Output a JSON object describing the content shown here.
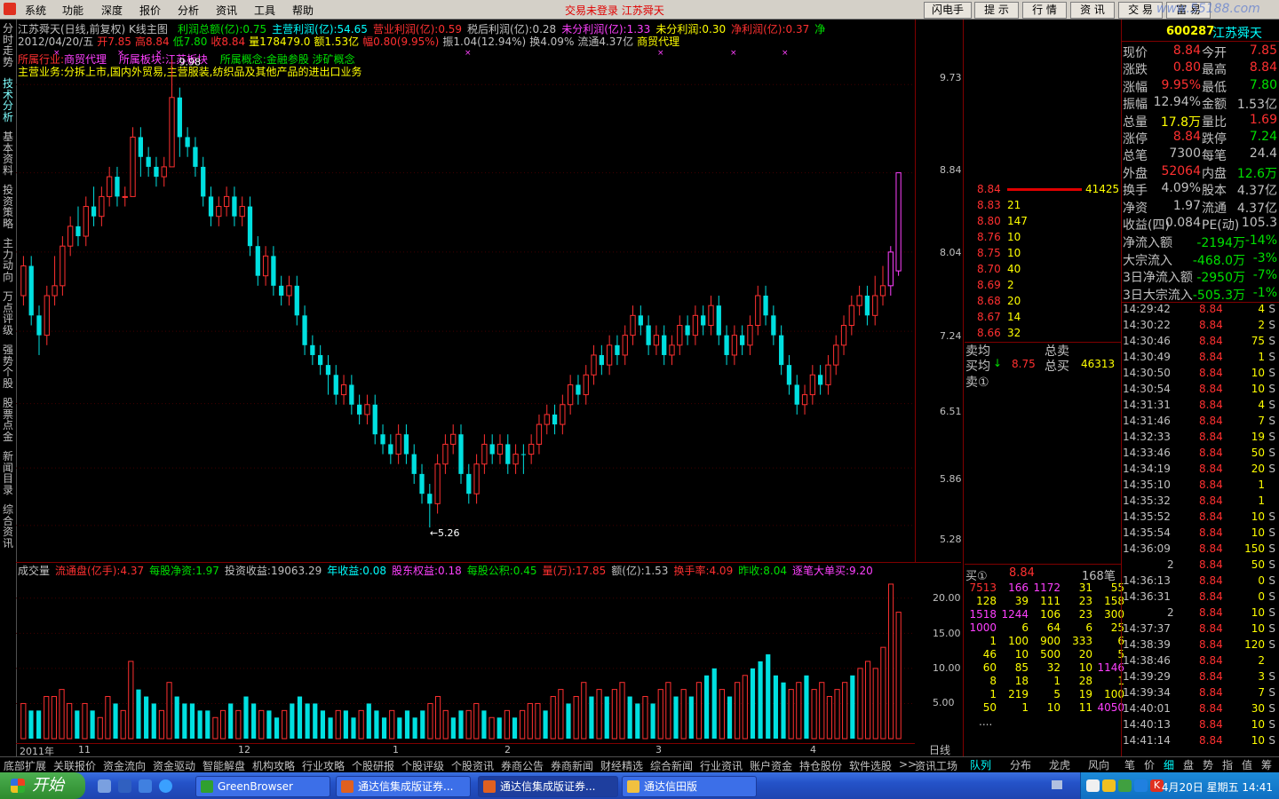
{
  "menubar": {
    "items": [
      "系统",
      "功能",
      "深度",
      "报价",
      "分析",
      "资讯",
      "工具",
      "帮助"
    ],
    "status": "交易未登录  江苏舜天",
    "right_buttons": [
      "闪电手",
      "提 示",
      "行 情",
      "资 讯",
      "交 易",
      "富 易"
    ],
    "watermark": "www.55188.com"
  },
  "left_tabs": [
    "分时走势",
    "技术分析",
    "基本资料",
    "投资策略",
    "主力动向",
    "万点评级",
    "强势个股",
    "股票点金",
    "新闻目录",
    "综合资讯"
  ],
  "info": {
    "title": "江苏舜天(日线,前复权) K线主图",
    "fin1": [
      {
        "t": "利润总额(亿):0.75",
        "c": "g"
      },
      {
        "t": "主营利润(亿):54.65",
        "c": "c"
      },
      {
        "t": "营业利润(亿):0.59",
        "c": "r"
      },
      {
        "t": "税后利润(亿):0.28",
        "c": "w"
      },
      {
        "t": "未分利润(亿):1.33",
        "c": "m"
      },
      {
        "t": "未分利润:0.30",
        "c": "y"
      },
      {
        "t": "净利润(亿):0.37",
        "c": "r"
      },
      {
        "t": "净",
        "c": "g"
      }
    ],
    "kline": [
      {
        "t": "2012/04/20/五",
        "c": "w"
      },
      {
        "t": "开7.85",
        "c": "r"
      },
      {
        "t": "高8.84",
        "c": "r"
      },
      {
        "t": "低7.80",
        "c": "g"
      },
      {
        "t": "收8.84",
        "c": "r"
      },
      {
        "t": "量178479.0",
        "c": "y"
      },
      {
        "t": "额1.53亿",
        "c": "y"
      },
      {
        "t": "幅0.80(9.95%)",
        "c": "r"
      },
      {
        "t": "振1.04(12.94%)",
        "c": "w"
      },
      {
        "t": "换4.09%",
        "c": "w"
      },
      {
        "t": "流通4.37亿",
        "c": "w"
      },
      {
        "t": "商贸代理",
        "c": "y"
      }
    ],
    "industry_label": "所属行业:",
    "industry_value": "商贸代理",
    "board_label": "所属板块:",
    "board_value": "江苏板块",
    "concept_label": "所属概念:",
    "concept_value": "金融参股 涉矿概念",
    "main_label": "主营业务:",
    "main_value": "分拆上市,国内外贸易,主营服装,纺织品及其他产品的进出口业务",
    "pointer_label": "9.98",
    "low_label": "←5.26"
  },
  "kchart": {
    "yaxis": [
      "9.73",
      "8.84",
      "8.04",
      "7.24",
      "6.51",
      "5.86",
      "5.28"
    ],
    "xlabels": [
      "2011年",
      "11",
      "12",
      "1",
      "2",
      "3",
      "4"
    ],
    "period": "日线"
  },
  "vol": {
    "header": [
      {
        "t": "成交量",
        "c": "w"
      },
      {
        "t": "流通盘(亿手):4.37",
        "c": "r"
      },
      {
        "t": "每股净资:1.97",
        "c": "g"
      },
      {
        "t": "投资收益:19063.29",
        "c": "w"
      },
      {
        "t": "年收益:0.08",
        "c": "c"
      },
      {
        "t": "股东权益:0.18",
        "c": "m"
      },
      {
        "t": "每股公积:0.45",
        "c": "g"
      },
      {
        "t": "量(万):17.85",
        "c": "r"
      },
      {
        "t": "额(亿):1.53",
        "c": "w"
      },
      {
        "t": "换手率:4.09",
        "c": "r"
      },
      {
        "t": "昨收:8.04",
        "c": "g"
      },
      {
        "t": "逐笔大单买:9.20",
        "c": "m"
      }
    ],
    "yaxis": [
      "20.00",
      "15.00",
      "10.00",
      "5.00"
    ]
  },
  "chart_data": {
    "type": "candlestick",
    "title": "江苏舜天(日线,前复权) K线主图",
    "ylim": [
      5.1,
      10.1
    ],
    "candles": [
      [
        7.6,
        7.9,
        7.5,
        8.0,
        1
      ],
      [
        7.9,
        7.4,
        7.3,
        8.0,
        0
      ],
      [
        7.4,
        7.2,
        7.0,
        7.5,
        0
      ],
      [
        7.2,
        7.6,
        7.1,
        7.7,
        1
      ],
      [
        7.6,
        7.7,
        7.5,
        8.0,
        1
      ],
      [
        7.7,
        8.1,
        7.6,
        8.2,
        1
      ],
      [
        8.1,
        8.3,
        8.0,
        8.4,
        1
      ],
      [
        8.3,
        8.2,
        8.1,
        8.5,
        0
      ],
      [
        8.2,
        8.5,
        8.1,
        8.6,
        1
      ],
      [
        8.5,
        8.4,
        8.3,
        8.7,
        0
      ],
      [
        8.4,
        8.6,
        8.3,
        8.7,
        1
      ],
      [
        8.6,
        8.8,
        8.5,
        8.9,
        1
      ],
      [
        8.8,
        8.6,
        8.5,
        8.9,
        0
      ],
      [
        8.6,
        8.6,
        8.5,
        8.7,
        1
      ],
      [
        8.6,
        9.2,
        8.6,
        9.3,
        1
      ],
      [
        9.2,
        9.0,
        8.8,
        9.3,
        0
      ],
      [
        9.0,
        8.9,
        8.8,
        9.1,
        0
      ],
      [
        8.9,
        8.8,
        8.7,
        9.0,
        0
      ],
      [
        8.8,
        8.9,
        8.7,
        9.0,
        1
      ],
      [
        8.9,
        9.6,
        8.9,
        9.98,
        1
      ],
      [
        9.6,
        9.2,
        9.0,
        9.7,
        0
      ],
      [
        9.2,
        9.1,
        9.0,
        9.3,
        0
      ],
      [
        9.1,
        8.9,
        8.8,
        9.2,
        0
      ],
      [
        8.9,
        8.6,
        8.5,
        9.0,
        0
      ],
      [
        8.6,
        8.4,
        8.3,
        8.7,
        0
      ],
      [
        8.4,
        8.5,
        8.3,
        8.6,
        1
      ],
      [
        8.5,
        8.6,
        8.4,
        8.7,
        1
      ],
      [
        8.6,
        8.4,
        8.3,
        8.7,
        0
      ],
      [
        8.4,
        8.5,
        8.3,
        8.6,
        1
      ],
      [
        8.5,
        8.1,
        8.0,
        8.6,
        0
      ],
      [
        8.1,
        7.8,
        7.7,
        8.2,
        0
      ],
      [
        7.8,
        8.0,
        7.7,
        8.1,
        1
      ],
      [
        8.0,
        7.7,
        7.6,
        8.1,
        0
      ],
      [
        7.7,
        7.6,
        7.5,
        7.8,
        0
      ],
      [
        7.6,
        7.7,
        7.5,
        7.8,
        1
      ],
      [
        7.7,
        7.4,
        7.3,
        7.8,
        0
      ],
      [
        7.4,
        7.1,
        7.0,
        7.5,
        0
      ],
      [
        7.1,
        7.0,
        6.9,
        7.2,
        0
      ],
      [
        7.0,
        6.9,
        6.8,
        7.1,
        0
      ],
      [
        6.9,
        6.8,
        6.6,
        7.0,
        0
      ],
      [
        6.8,
        6.6,
        6.5,
        6.9,
        0
      ],
      [
        6.6,
        6.7,
        6.5,
        6.8,
        1
      ],
      [
        6.7,
        6.5,
        6.4,
        6.8,
        0
      ],
      [
        6.5,
        6.4,
        6.3,
        6.6,
        0
      ],
      [
        6.4,
        6.5,
        6.3,
        6.6,
        1
      ],
      [
        6.5,
        6.2,
        6.1,
        6.6,
        0
      ],
      [
        6.2,
        6.1,
        6.0,
        6.3,
        0
      ],
      [
        6.1,
        6.0,
        5.9,
        6.2,
        0
      ],
      [
        6.0,
        6.2,
        5.9,
        6.3,
        1
      ],
      [
        6.2,
        6.0,
        5.9,
        6.3,
        0
      ],
      [
        6.0,
        5.8,
        5.7,
        6.1,
        0
      ],
      [
        5.8,
        5.6,
        5.5,
        5.9,
        0
      ],
      [
        5.6,
        5.5,
        5.26,
        5.7,
        0
      ],
      [
        5.5,
        5.9,
        5.4,
        6.0,
        1
      ],
      [
        5.9,
        6.1,
        5.8,
        6.2,
        1
      ],
      [
        6.1,
        6.2,
        6.0,
        6.3,
        1
      ],
      [
        6.2,
        5.8,
        5.7,
        6.3,
        0
      ],
      [
        5.8,
        5.6,
        5.5,
        5.9,
        0
      ],
      [
        5.6,
        5.9,
        5.5,
        6.0,
        1
      ],
      [
        5.9,
        6.1,
        5.8,
        6.2,
        1
      ],
      [
        6.1,
        6.0,
        5.9,
        6.2,
        0
      ],
      [
        6.0,
        6.1,
        5.9,
        6.2,
        1
      ],
      [
        6.1,
        5.9,
        5.8,
        6.2,
        0
      ],
      [
        5.9,
        6.0,
        5.8,
        6.1,
        1
      ],
      [
        6.0,
        6.0,
        5.8,
        6.1,
        0
      ],
      [
        6.0,
        6.1,
        5.9,
        6.2,
        1
      ],
      [
        6.1,
        6.3,
        6.0,
        6.4,
        1
      ],
      [
        6.3,
        6.4,
        6.2,
        6.5,
        1
      ],
      [
        6.4,
        6.3,
        6.2,
        6.5,
        0
      ],
      [
        6.3,
        6.5,
        6.2,
        6.6,
        1
      ],
      [
        6.5,
        6.7,
        6.4,
        6.8,
        1
      ],
      [
        6.7,
        6.6,
        6.5,
        6.8,
        0
      ],
      [
        6.6,
        6.8,
        6.5,
        6.9,
        1
      ],
      [
        6.8,
        7.0,
        6.7,
        7.1,
        1
      ],
      [
        7.0,
        6.9,
        6.8,
        7.1,
        0
      ],
      [
        6.9,
        7.1,
        6.8,
        7.2,
        1
      ],
      [
        7.1,
        7.0,
        6.9,
        7.2,
        0
      ],
      [
        7.0,
        7.2,
        6.9,
        7.3,
        1
      ],
      [
        7.2,
        7.4,
        7.1,
        7.5,
        1
      ],
      [
        7.4,
        7.3,
        7.2,
        7.5,
        0
      ],
      [
        7.3,
        7.1,
        7.0,
        7.4,
        0
      ],
      [
        7.1,
        7.2,
        7.0,
        7.3,
        1
      ],
      [
        7.2,
        7.0,
        6.9,
        7.3,
        0
      ],
      [
        7.0,
        7.1,
        6.9,
        7.2,
        1
      ],
      [
        7.1,
        7.3,
        7.0,
        7.4,
        1
      ],
      [
        7.3,
        7.2,
        7.1,
        7.4,
        0
      ],
      [
        7.2,
        7.4,
        7.1,
        7.5,
        1
      ],
      [
        7.4,
        7.3,
        7.2,
        7.5,
        0
      ],
      [
        7.3,
        7.5,
        7.2,
        7.6,
        1
      ],
      [
        7.5,
        7.2,
        7.1,
        7.6,
        0
      ],
      [
        7.2,
        7.0,
        6.9,
        7.3,
        0
      ],
      [
        7.0,
        7.2,
        6.9,
        7.3,
        1
      ],
      [
        7.2,
        7.1,
        7.0,
        7.3,
        0
      ],
      [
        7.1,
        7.3,
        7.0,
        7.4,
        1
      ],
      [
        7.3,
        7.6,
        7.2,
        7.7,
        1
      ],
      [
        7.6,
        7.4,
        7.3,
        7.7,
        0
      ],
      [
        7.4,
        7.2,
        7.1,
        7.5,
        0
      ],
      [
        7.2,
        6.9,
        6.8,
        7.3,
        0
      ],
      [
        6.9,
        6.7,
        6.6,
        7.0,
        0
      ],
      [
        6.7,
        6.5,
        6.4,
        6.8,
        0
      ],
      [
        6.5,
        6.6,
        6.4,
        6.7,
        1
      ],
      [
        6.6,
        6.8,
        6.5,
        6.9,
        1
      ],
      [
        6.8,
        6.7,
        6.6,
        6.9,
        0
      ],
      [
        6.7,
        6.9,
        6.6,
        7.0,
        1
      ],
      [
        6.9,
        7.1,
        6.8,
        7.2,
        1
      ],
      [
        7.1,
        7.3,
        7.0,
        7.4,
        1
      ],
      [
        7.3,
        7.5,
        7.2,
        7.6,
        1
      ],
      [
        7.5,
        7.6,
        7.4,
        7.7,
        1
      ],
      [
        7.6,
        7.4,
        7.3,
        7.7,
        0
      ],
      [
        7.4,
        7.6,
        7.3,
        7.8,
        1
      ],
      [
        7.6,
        7.7,
        7.5,
        7.9,
        1
      ],
      [
        7.7,
        8.04,
        7.6,
        8.1,
        1
      ],
      [
        7.85,
        8.84,
        7.8,
        8.84,
        1
      ]
    ],
    "volumes": [
      5,
      4,
      4,
      6,
      6,
      7,
      5,
      4,
      5,
      4,
      3,
      6,
      5,
      4,
      11,
      7,
      6,
      5,
      4,
      8,
      6,
      5,
      5,
      4,
      4,
      3,
      4,
      5,
      4,
      6,
      5,
      4,
      4,
      3,
      4,
      5,
      6,
      5,
      5,
      4,
      3,
      4,
      4,
      3,
      4,
      5,
      4,
      3,
      4,
      3,
      4,
      3,
      4,
      5,
      6,
      4,
      3,
      4,
      4,
      5,
      4,
      3,
      3,
      4,
      3,
      4,
      5,
      5,
      4,
      6,
      7,
      5,
      6,
      8,
      6,
      7,
      6,
      7,
      8,
      6,
      5,
      6,
      5,
      7,
      8,
      6,
      7,
      6,
      8,
      9,
      10,
      7,
      6,
      8,
      9,
      10,
      11,
      12,
      9,
      8,
      7,
      8,
      9,
      7,
      8,
      6,
      7,
      8,
      9,
      10,
      11,
      10,
      13,
      22,
      18
    ]
  },
  "orderbook": {
    "sells": [
      [
        "8.84",
        "41425"
      ],
      [
        "8.83",
        "21"
      ],
      [
        "8.80",
        "147"
      ],
      [
        "8.76",
        "10"
      ],
      [
        "8.75",
        "10"
      ],
      [
        "8.70",
        "40"
      ],
      [
        "8.69",
        "2"
      ],
      [
        "8.68",
        "20"
      ],
      [
        "8.67",
        "14"
      ],
      [
        "8.66",
        "32"
      ]
    ],
    "avg_sell": "卖均",
    "total_sell": "总卖",
    "avg_buy": "买均",
    "avg_buy_price": "8.75",
    "total_buy": "总买",
    "total_buy_value": "46313",
    "sell1": "卖①",
    "buy1_label": "买①",
    "buy1_price": "8.84",
    "buy1_count": "168笔",
    "queue": [
      [
        "7513",
        "166",
        "1172",
        "31",
        "55"
      ],
      [
        "128",
        "39",
        "111",
        "23",
        "158"
      ],
      [
        "1518",
        "1244",
        "106",
        "23",
        "300"
      ],
      [
        "1000",
        "6",
        "64",
        "6",
        "25"
      ],
      [
        "1",
        "100",
        "900",
        "333",
        "6"
      ],
      [
        "46",
        "10",
        "500",
        "20",
        "5"
      ],
      [
        "60",
        "85",
        "32",
        "10",
        "1146"
      ],
      [
        "8",
        "18",
        "1",
        "28",
        "1"
      ],
      [
        "1",
        "219",
        "5",
        "19",
        "100"
      ],
      [
        "50",
        "1",
        "10",
        "11",
        "4050"
      ]
    ],
    "more": "....",
    "tabs": [
      "队列",
      "分布",
      "龙虎",
      "风向"
    ]
  },
  "quote": {
    "code": "600287",
    "name": "江苏舜天",
    "rows": [
      [
        [
          "现价",
          "8.84",
          "r"
        ],
        [
          "今开",
          "7.85",
          "r"
        ]
      ],
      [
        [
          "涨跌",
          "0.80",
          "r"
        ],
        [
          "最高",
          "8.84",
          "r"
        ]
      ],
      [
        [
          "涨幅",
          "9.95%",
          "r"
        ],
        [
          "最低",
          "7.80",
          "g"
        ]
      ],
      [
        [
          "振幅",
          "12.94%",
          "w"
        ],
        [
          "金额",
          "1.53亿",
          "w"
        ]
      ],
      [
        [
          "总量",
          "17.8万",
          "y"
        ],
        [
          "量比",
          "1.69",
          "r"
        ]
      ],
      [
        [
          "涨停",
          "8.84",
          "r"
        ],
        [
          "跌停",
          "7.24",
          "g"
        ]
      ],
      [
        [
          "总笔",
          "7300",
          "w"
        ],
        [
          "每笔",
          "24.4",
          "w"
        ]
      ],
      [
        [
          "外盘",
          "52064",
          "r"
        ],
        [
          "内盘",
          "12.6万",
          "g"
        ]
      ],
      [
        [
          "换手",
          "4.09%",
          "w"
        ],
        [
          "股本",
          "4.37亿",
          "w"
        ]
      ],
      [
        [
          "净资",
          "1.97",
          "w"
        ],
        [
          "流通",
          "4.37亿",
          "w"
        ]
      ],
      [
        [
          "收益(四)",
          "0.084",
          "w"
        ],
        [
          "PE(动)",
          "105.3",
          "w"
        ]
      ]
    ],
    "flows": [
      [
        "净流入额",
        "-2194万",
        "-14%"
      ],
      [
        "大宗流入",
        "-468.0万",
        "-3%"
      ],
      [
        "3日净流入额",
        "-2950万",
        "-7%"
      ],
      [
        "3日大宗流入",
        "-505.3万",
        "-1%"
      ]
    ]
  },
  "ticks": [
    [
      "14:29:42",
      "8.84",
      "4",
      "S"
    ],
    [
      "14:30:22",
      "8.84",
      "2",
      "S"
    ],
    [
      "14:30:46",
      "8.84",
      "75",
      "S"
    ],
    [
      "14:30:49",
      "8.84",
      "1",
      "S"
    ],
    [
      "14:30:50",
      "8.84",
      "10",
      "S"
    ],
    [
      "14:30:54",
      "8.84",
      "10",
      "S"
    ],
    [
      "14:31:31",
      "8.84",
      "4",
      "S"
    ],
    [
      "14:31:46",
      "8.84",
      "7",
      "S"
    ],
    [
      "14:32:33",
      "8.84",
      "19",
      "S"
    ],
    [
      "14:33:46",
      "8.84",
      "50",
      "S"
    ],
    [
      "14:34:19",
      "8.84",
      "20",
      "S"
    ],
    [
      "14:35:10",
      "8.84",
      "1",
      ""
    ],
    [
      "14:35:32",
      "8.84",
      "1",
      ""
    ],
    [
      "14:35:52",
      "8.84",
      "10",
      "S"
    ],
    [
      "14:35:54",
      "8.84",
      "10",
      "S"
    ],
    [
      "14:36:09",
      "8.84",
      "150",
      "S"
    ],
    [
      "2",
      "8.84",
      "50",
      "S"
    ],
    [
      "14:36:13",
      "8.84",
      "0",
      "S"
    ],
    [
      "14:36:31",
      "8.84",
      "0",
      "S"
    ],
    [
      "2",
      "8.84",
      "10",
      "S"
    ],
    [
      "14:37:37",
      "8.84",
      "10",
      "S"
    ],
    [
      "14:38:39",
      "8.84",
      "120",
      "S"
    ],
    [
      "14:38:46",
      "8.84",
      "2",
      ""
    ],
    [
      "14:39:29",
      "8.84",
      "3",
      "S"
    ],
    [
      "14:39:34",
      "8.84",
      "7",
      "S"
    ],
    [
      "14:40:01",
      "8.84",
      "30",
      "S"
    ],
    [
      "14:40:13",
      "8.84",
      "10",
      "S"
    ],
    [
      "14:41:14",
      "8.84",
      "10",
      "S"
    ]
  ],
  "right_tabs": [
    "笔",
    "价",
    "细",
    "盘",
    "势",
    "指",
    "值",
    "筹"
  ],
  "bottom_tabs": [
    "底部扩展",
    "关联报价",
    "资金流向",
    "资金驱动",
    "智能解盘",
    "机构攻略",
    "行业攻略",
    "个股研报",
    "个股评级",
    "个股资讯",
    "券商公告",
    "券商新闻",
    "财经精选",
    "综合新闻",
    "行业资讯",
    "账户资金",
    "持仓股份",
    "软件选股",
    ">>",
    "资讯工场"
  ],
  "taskbar": {
    "start": "开始",
    "tasks": [
      "GreenBrowser",
      "通达信集成版证券...",
      "通达信集成版证券...",
      "通达信田版"
    ],
    "clock": "4月20日 星期五 14:41"
  },
  "colors": {
    "up": "#ff3030",
    "down": "#00e0e0",
    "flat": "#ffffff",
    "accent": "#800000"
  }
}
